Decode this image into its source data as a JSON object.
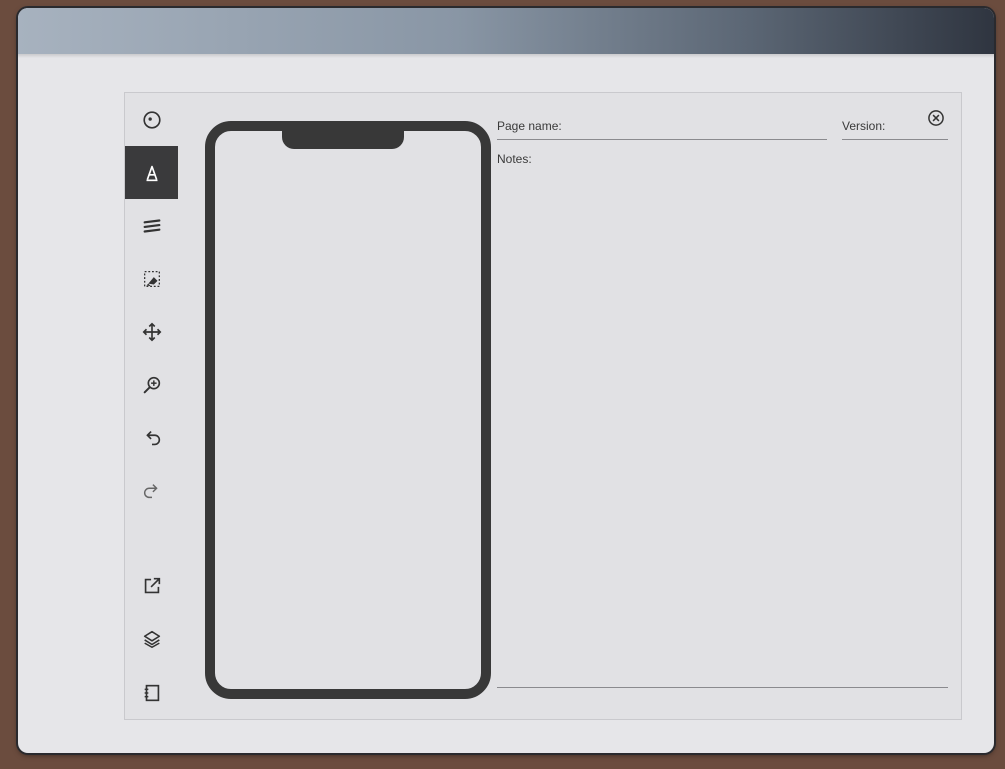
{
  "toolbar": {
    "items": [
      {
        "name": "settings-icon"
      },
      {
        "name": "pen-tool-icon",
        "active": true
      },
      {
        "name": "stroke-width-icon"
      },
      {
        "name": "selection-eraser-icon"
      },
      {
        "name": "move-icon"
      },
      {
        "name": "zoom-in-icon"
      },
      {
        "name": "undo-icon"
      },
      {
        "name": "redo-icon"
      },
      {
        "name": "export-icon"
      },
      {
        "name": "layers-icon"
      },
      {
        "name": "notebook-icon"
      }
    ]
  },
  "form": {
    "page_name_label": "Page name:",
    "version_label": "Version:",
    "notes_label": "Notes:"
  },
  "colors": {
    "accent": "#3a3a3c",
    "frame": "#383838"
  }
}
